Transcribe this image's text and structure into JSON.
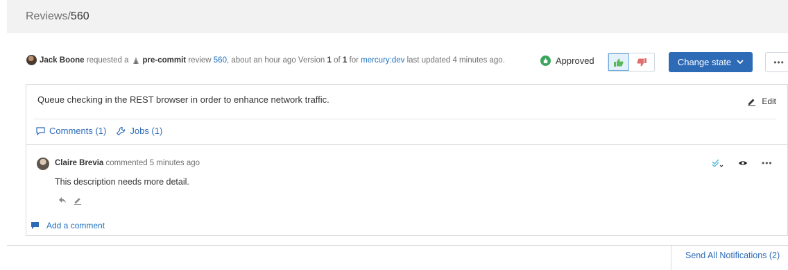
{
  "breadcrumb": {
    "parent": "Reviews",
    "separator": "/",
    "current": "560"
  },
  "review": {
    "author": "Jack Boone",
    "requested_text": "requested a",
    "type": "pre-commit",
    "review_word": "review",
    "review_id": "560",
    "time_text": ", about an hour ago Version",
    "version": "1",
    "of_text": "of",
    "version_total": "1",
    "for_text": "for",
    "branch": "mercury:dev",
    "updated_text": "last updated 4 minutes ago."
  },
  "status": {
    "label": "Approved",
    "color": "#3aa55b"
  },
  "actions": {
    "change_state_label": "Change state",
    "more_label": "•••"
  },
  "description": {
    "text": "Queue checking in the REST browser in order to enhance network traffic.",
    "edit_label": "Edit"
  },
  "tabs": [
    {
      "label": "Comments (1)",
      "icon": "comment-icon"
    },
    {
      "label": "Jobs (1)",
      "icon": "wrench-icon"
    }
  ],
  "comment": {
    "author": "Claire Brevia",
    "meta": "commented 5 minutes ago",
    "body": "This description needs more detail.",
    "more_label": "•••"
  },
  "add_comment_label": "Add a comment",
  "send_all_label": "Send All Notifications (2)",
  "colors": {
    "accent": "#2d6bb7",
    "link": "#1f6fbf",
    "approved": "#3aa55b",
    "vote_down": "#e06d6d",
    "vote_up": "#5cb85c"
  }
}
